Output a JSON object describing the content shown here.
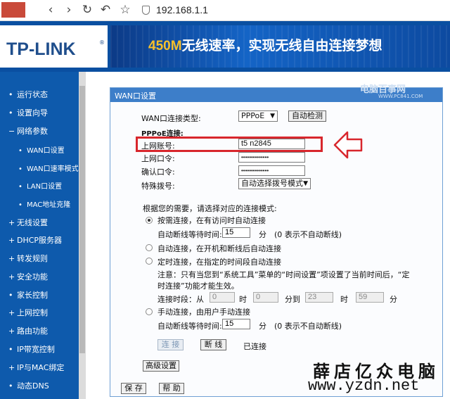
{
  "browser": {
    "back_icon": "back-icon",
    "forward_icon": "forward-icon",
    "reload_icon": "reload-icon",
    "home_icon": "home-icon",
    "star_icon": "star-icon",
    "url": "192.168.1.1"
  },
  "header": {
    "logo": "TP-LINK",
    "slogan_number": "450M",
    "slogan_text": "无线速率，实现无线自由连接梦想"
  },
  "sidebar": {
    "items": [
      {
        "label": "运行状态",
        "marker": "•"
      },
      {
        "label": "设置向导",
        "marker": "•"
      },
      {
        "label": "网络参数",
        "marker": "−"
      },
      {
        "label": "WAN口设置",
        "marker": "•"
      },
      {
        "label": "WAN口速率模式",
        "marker": "•"
      },
      {
        "label": "LAN口设置",
        "marker": "•"
      },
      {
        "label": "MAC地址克隆",
        "marker": "•"
      },
      {
        "label": "无线设置",
        "marker": "+"
      },
      {
        "label": "DHCP服务器",
        "marker": "+"
      },
      {
        "label": "转发规则",
        "marker": "+"
      },
      {
        "label": "安全功能",
        "marker": "+"
      },
      {
        "label": "家长控制",
        "marker": "•"
      },
      {
        "label": "上网控制",
        "marker": "+"
      },
      {
        "label": "路由功能",
        "marker": "+"
      },
      {
        "label": "IP带宽控制",
        "marker": "•"
      },
      {
        "label": "IP与MAC绑定",
        "marker": "+"
      },
      {
        "label": "动态DNS",
        "marker": "•"
      }
    ]
  },
  "panel": {
    "title": "WAN口设置",
    "watermark": "电脑百事网",
    "watermark_url": "WWW.PC841.COM",
    "wan_type_label": "WAN口连接类型:",
    "wan_type_value": "PPPoE",
    "auto_detect": "自动检测",
    "pppoe_section": "PPPoE连接:",
    "account_label": "上网账号:",
    "account_value": "t5    n2845",
    "password_label": "上网口令:",
    "password_value": "••••••••••••••",
    "confirm_label": "确认口令:",
    "confirm_value": "••••••••••••••",
    "dial_label": "特殊拨号:",
    "dial_value": "自动选择拨号模式",
    "mode_intro": "根据您的需要，请选择对应的连接模式:",
    "mode_demand": "按需连接，在有访问时自动连接",
    "idle_label": "自动断线等待时间:",
    "idle_value": "15",
    "idle_unit": "分",
    "idle_note": "(0 表示不自动断线)",
    "mode_auto": "自动连接，在开机和断线后自动连接",
    "mode_timed": "定时连接，在指定的时间段自动连接",
    "timed_note_1": "注意：只有当您到“系统工具”菜单的“时间设置”项设置了当前时间后，“定",
    "timed_note_2": "时连接”功能才能生效。",
    "period_label": "连接时段：从",
    "period_from_h": "0",
    "period_h_unit": "时",
    "period_from_m": "0",
    "period_to": "分到",
    "period_to_h": "23",
    "period_to_h_unit": "时",
    "period_to_m": "59",
    "period_m_unit": "分",
    "mode_manual": "手动连接，由用户手动连接",
    "idle2_label": "自动断线等待时间:",
    "idle2_value": "15",
    "idle2_unit": "分",
    "idle2_note": "(0 表示不自动断线)",
    "connect": "连 接",
    "disconnect": "断 线",
    "status": "已连接",
    "advanced": "高级设置",
    "save": "保 存",
    "help": "帮 助"
  },
  "footer_watermark": {
    "name": "薛店亿众电脑",
    "url": "www.yzdn.net"
  },
  "colors": {
    "header_blue": "#0a4fa1",
    "sidebar_blue": "#0e5aac",
    "highlight_red": "#d8262c",
    "slogan_gold": "#f7c02a"
  }
}
